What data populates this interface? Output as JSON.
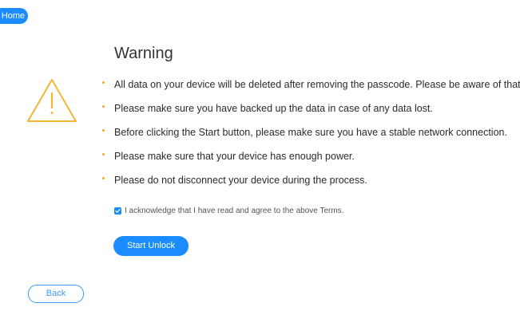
{
  "nav": {
    "home_label": "Home",
    "back_label": "Back"
  },
  "warning": {
    "title": "Warning",
    "icon": "warning-triangle-icon",
    "items": [
      "All data on your device will be deleted after removing the passcode. Please be aware of that.",
      "Please make sure you have backed up the data in case of any data lost.",
      "Before clicking the Start button, please make sure you have a stable network connection.",
      "Please make sure that your device has enough power.",
      "Please do not disconnect your device during the process."
    ]
  },
  "terms": {
    "checked": true,
    "label": "I acknowledge that I have read and agree to the above Terms."
  },
  "actions": {
    "start_label": "Start Unlock"
  },
  "colors": {
    "accent": "#1a8cff",
    "warning": "#f5b731",
    "bullet": "#f5a623"
  }
}
